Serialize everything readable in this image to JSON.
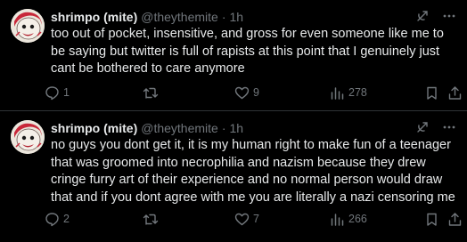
{
  "tweets": [
    {
      "display_name": "shrimpo (mite)",
      "handle": "@theythemite",
      "separator": "·",
      "time": "1h",
      "text": "too out of pocket, insensitive, and gross for even someone like me to be saying but twitter is full of rapists at this point that I genuinely just cant be bothered to care anymore",
      "reply_count": "1",
      "retweet_count": "",
      "like_count": "9",
      "view_count": "278"
    },
    {
      "display_name": "shrimpo (mite)",
      "handle": "@theythemite",
      "separator": "·",
      "time": "1h",
      "text": "no guys you dont get it, it is my human right to make fun of a teenager that was groomed into necrophilia and nazism because they drew cringe furry art of their experience and no normal person would draw that and if you dont agree with me you are literally a nazi censoring me",
      "reply_count": "2",
      "retweet_count": "",
      "like_count": "7",
      "view_count": "266"
    }
  ],
  "icons": [
    "grok-icon",
    "more-icon",
    "reply-icon",
    "retweet-icon",
    "like-icon",
    "views-icon",
    "bookmark-icon",
    "share-icon"
  ],
  "colors": {
    "background": "#000000",
    "text": "#e7e9ea",
    "secondary": "#71767b",
    "divider": "#2f3336"
  }
}
